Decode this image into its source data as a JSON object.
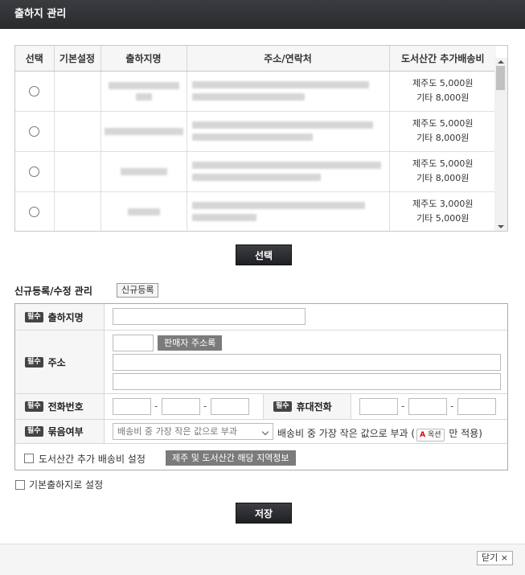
{
  "window": {
    "title": "출하지 관리"
  },
  "table": {
    "headers": [
      "선택",
      "기본설정",
      "출하지명",
      "주소/연락처",
      "도서산간 추가배송비"
    ],
    "rows": [
      {
        "fee_line1": "제주도 5,000원",
        "fee_line2": "기타 8,000원"
      },
      {
        "fee_line1": "제주도 5,000원",
        "fee_line2": "기타 8,000원"
      },
      {
        "fee_line1": "제주도 5,000원",
        "fee_line2": "기타 8,000원"
      },
      {
        "fee_line1": "제주도 3,000원",
        "fee_line2": "기타 5,000원"
      }
    ]
  },
  "select_button": "선택",
  "section": {
    "title": "신규등록/수정 관리",
    "new_button": "신규등록"
  },
  "form": {
    "required_badge": "필수",
    "name_label": "출하지명",
    "address_label": "주소",
    "seller_address_button": "판매자 주소록",
    "phone_label": "전화번호",
    "mobile_label": "휴대전화",
    "dash": "-",
    "bundle_label": "묶음여부",
    "bundle_select_value": "배송비 중 가장 작은 값으로 부과",
    "bundle_text_before": "배송비 중 가장 작은 값으로 부과 (",
    "bundle_badge": "옥션",
    "bundle_text_after": "만 적용)",
    "remote_fee_label": "도서산간 추가 배송비 설정",
    "remote_region_button": "제주 및 도서산간 해당 지역정보"
  },
  "default_checkbox_label": "기본출하지로 설정",
  "save_button": "저장",
  "close_button": "닫기 ×"
}
